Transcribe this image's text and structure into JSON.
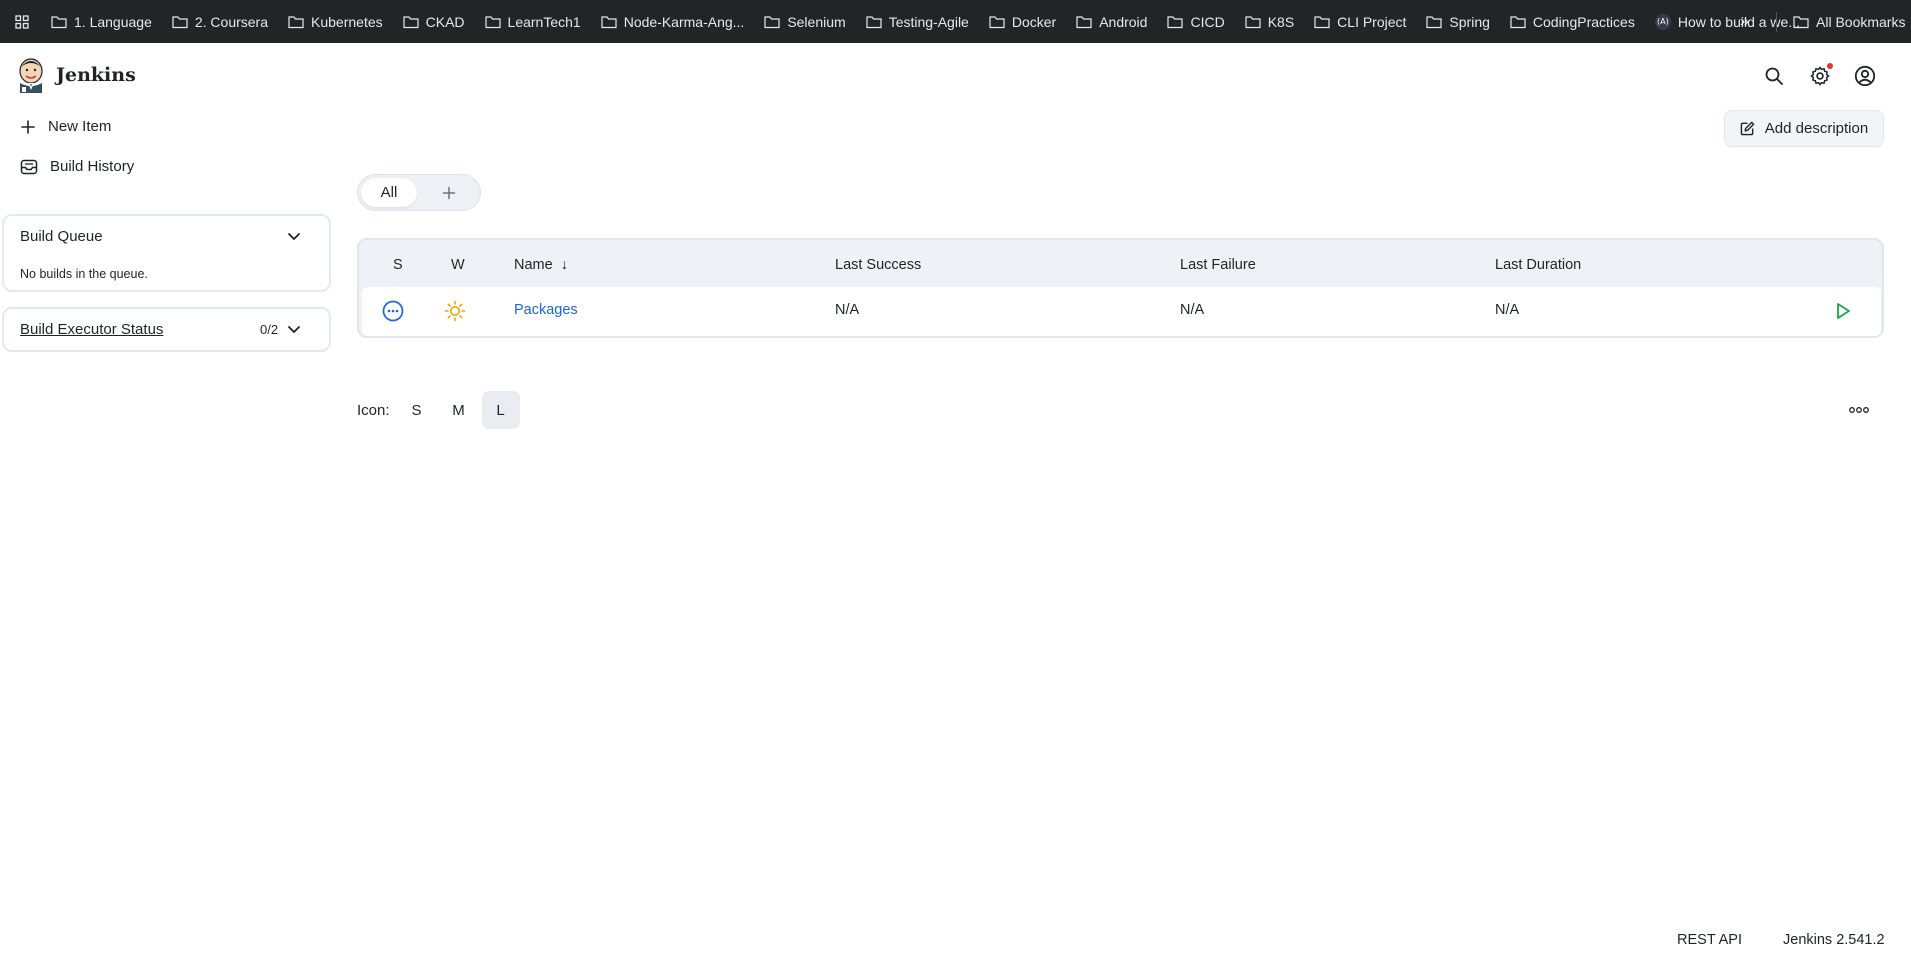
{
  "bookmarks": {
    "items": [
      "1. Language",
      "2. Coursera",
      "Kubernetes",
      "CKAD",
      "LearnTech1",
      "Node-Karma-Ang...",
      "Selenium",
      "Testing-Agile",
      "Docker",
      "Android",
      "CICD",
      "K8S",
      "CLI Project",
      "Spring",
      "CodingPractices"
    ],
    "special_item": "How to build a we...",
    "more": "»",
    "all_bookmarks": "All Bookmarks"
  },
  "header": {
    "brand": "Jenkins"
  },
  "sidebar": {
    "tasks": [
      {
        "label": "New Item",
        "icon": "plus-icon"
      },
      {
        "label": "Build History",
        "icon": "history-icon"
      }
    ],
    "build_queue": {
      "title": "Build Queue",
      "empty_text": "No builds in the queue."
    },
    "executor_status": {
      "title": "Build Executor Status",
      "count": "0/2"
    }
  },
  "main": {
    "add_description": "Add description",
    "tabs": {
      "active": "All",
      "add": "+"
    },
    "table": {
      "headers": {
        "status": "S",
        "weather": "W",
        "name": "Name",
        "sort_arrow": "↓",
        "last_success": "Last Success",
        "last_failure": "Last Failure",
        "last_duration": "Last Duration"
      },
      "rows": [
        {
          "name": "Packages",
          "last_success": "N/A",
          "last_failure": "N/A",
          "last_duration": "N/A",
          "status_icon": "not-built-icon",
          "weather_icon": "sunny-icon"
        }
      ]
    },
    "icon_size": {
      "label": "Icon:",
      "options": [
        "S",
        "M",
        "L"
      ],
      "selected": "L"
    }
  },
  "footer": {
    "rest_api": "REST API",
    "version": "Jenkins 2.541.2"
  },
  "colors": {
    "link": "#1967d2",
    "success_green": "#1ea446",
    "weather_orange": "#f0a500",
    "notification_red": "#e5322d"
  }
}
